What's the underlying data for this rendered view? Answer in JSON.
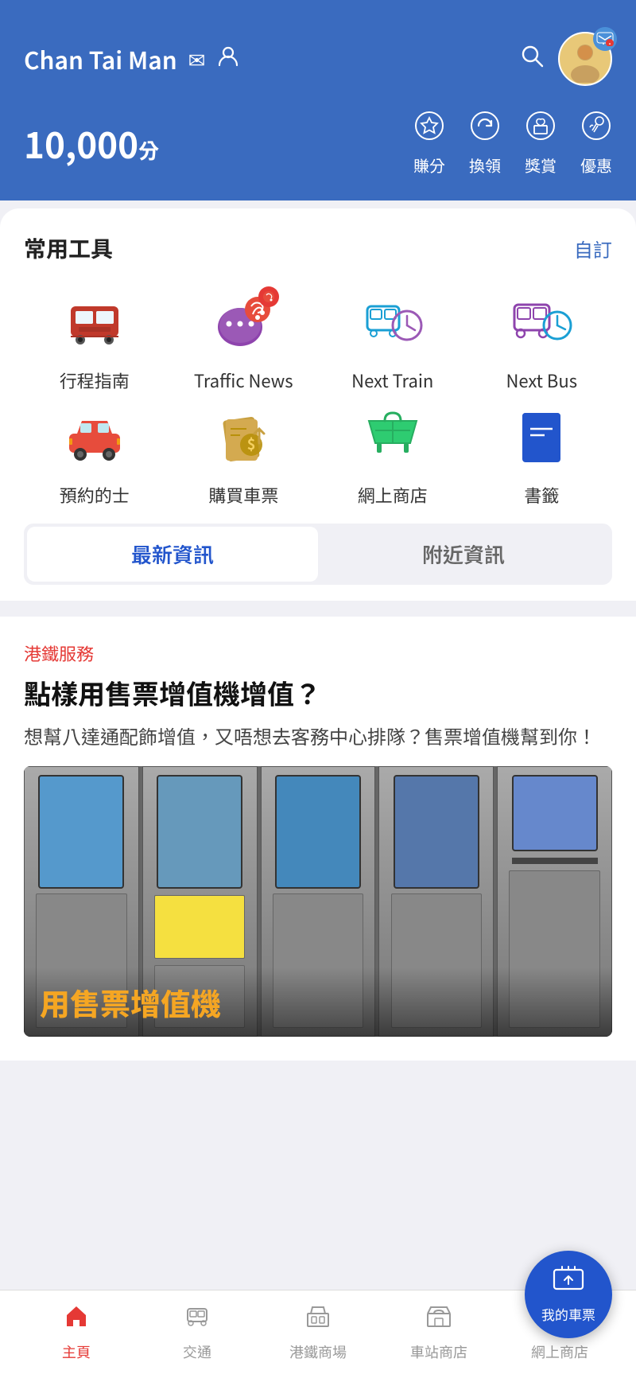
{
  "header": {
    "username": "Chan Tai Man",
    "mail_icon": "✉",
    "profile_icon": "👤",
    "search_icon": "🔍",
    "chat_icon": "💬",
    "points": "10,000",
    "points_unit": "分",
    "quick_actions": [
      {
        "id": "earn",
        "icon": "☆",
        "label": "賺分"
      },
      {
        "id": "redeem",
        "icon": "↻",
        "label": "換領"
      },
      {
        "id": "reward",
        "icon": "🎁",
        "label": "獎賞"
      },
      {
        "id": "offer",
        "icon": "📢",
        "label": "優惠"
      }
    ]
  },
  "tools_section": {
    "title": "常用工具",
    "action_label": "自訂",
    "tools_row1": [
      {
        "id": "journey",
        "label": "行程指南",
        "color": "#c0392b"
      },
      {
        "id": "traffic-news",
        "label": "Traffic News",
        "color": "#7b2fa8",
        "has_badge": true
      },
      {
        "id": "next-train",
        "label": "Next Train",
        "color": "#1a9fd4"
      },
      {
        "id": "next-bus",
        "label": "Next Bus",
        "color": "#7b2fa8"
      }
    ],
    "tools_row2": [
      {
        "id": "taxi",
        "label": "預約的士",
        "color": "#e74c3c"
      },
      {
        "id": "buy-ticket",
        "label": "購買車票",
        "color": "#b8860b"
      },
      {
        "id": "online-shop",
        "label": "網上商店",
        "color": "#27ae60"
      },
      {
        "id": "bookmark",
        "label": "書籤",
        "color": "#2255cc"
      }
    ]
  },
  "tabs": [
    {
      "id": "latest",
      "label": "最新資訊",
      "active": true
    },
    {
      "id": "nearby",
      "label": "附近資訊",
      "active": false
    }
  ],
  "news": {
    "category": "港鐵服務",
    "title": "點樣用售票增值機增值？",
    "description": "想幫八達通配飾增值，又唔想去客務中心排隊？售票增值機幫到你！",
    "image_caption": "用售票增值機"
  },
  "bottom_nav": [
    {
      "id": "home",
      "label": "主頁",
      "icon": "⊕",
      "active": true
    },
    {
      "id": "transport",
      "label": "交通",
      "icon": "🚇",
      "active": false
    },
    {
      "id": "mtr-mall",
      "label": "港鐵商場",
      "icon": "🏬",
      "active": false
    },
    {
      "id": "station-shop",
      "label": "車站商店",
      "icon": "🏪",
      "active": false
    },
    {
      "id": "online-shop-nav",
      "label": "網上商店",
      "icon": "🛒",
      "active": false
    }
  ],
  "fab": {
    "icon": "🎫",
    "label": "我的車票"
  }
}
